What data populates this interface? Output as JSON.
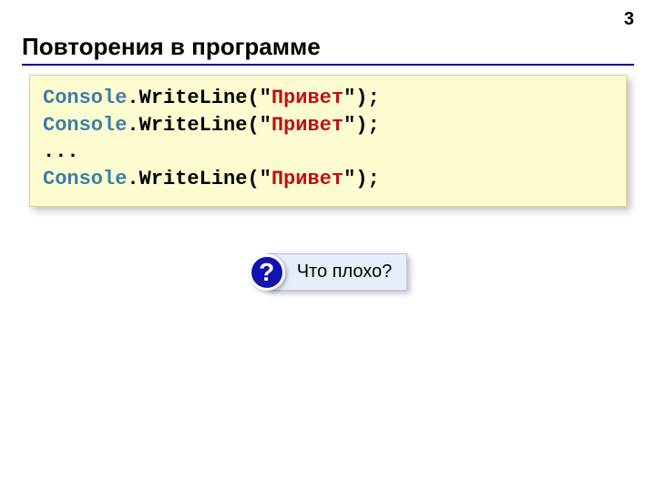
{
  "page_number": "3",
  "title": "Повторения в программе",
  "code": {
    "lines": [
      {
        "class": "Console",
        "dot": ".",
        "method": "WriteLine",
        "open": "(\"",
        "str": "Привет",
        "close": "\");"
      },
      {
        "class": "Console",
        "dot": ".",
        "method": "WriteLine",
        "open": "(\"",
        "str": "Привет",
        "close": "\");"
      },
      {
        "ellipsis": "..."
      },
      {
        "class": "Console",
        "dot": ".",
        "method": "WriteLine",
        "open": "(\"",
        "str": "Привет",
        "close": "\");"
      }
    ]
  },
  "callout": {
    "badge": "?",
    "text": "Что плохо?"
  }
}
